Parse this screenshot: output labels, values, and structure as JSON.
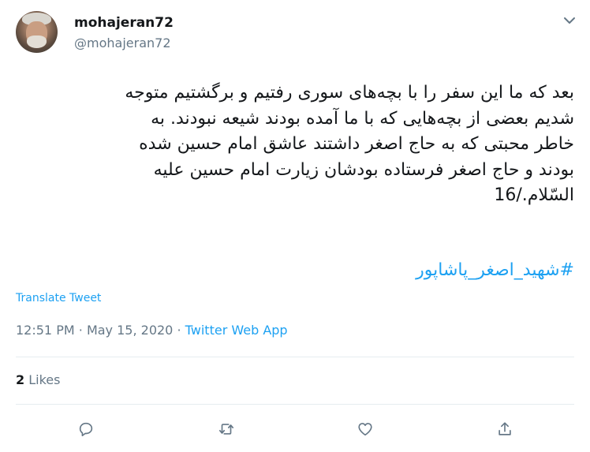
{
  "author": {
    "name": "mohajeran72",
    "handle": "@mohajeran72"
  },
  "tweet": {
    "text": "بعد که ما این سفر را با بچه‌های سوری رفتیم و برگشتیم متوجه\nشدیم بعضی از بچه‌هایی که با ما آمده بودند شیعه نبودند. به\nخاطر محبتی که به حاج اصغر داشتند عاشق امام حسین شده\nبودند و حاج اصغر فرستاده بودشان زیارت امام حسین علیه\nالسّلام./16",
    "hashtag": "#شهید_اصغر_پاشاپور",
    "translate_label": "Translate Tweet",
    "time": "12:51 PM",
    "separator": "·",
    "date": "May 15, 2020",
    "source": "Twitter Web App"
  },
  "stats": {
    "likes_count": "2",
    "likes_label": "Likes"
  },
  "icons": {
    "more": "chevron-down-icon",
    "reply": "reply-icon",
    "retweet": "retweet-icon",
    "like": "heart-icon",
    "share": "share-icon"
  },
  "colors": {
    "accent": "#1da1f2",
    "secondary_text": "#657786",
    "icon": "#657786",
    "divider": "#e6ecf0"
  }
}
